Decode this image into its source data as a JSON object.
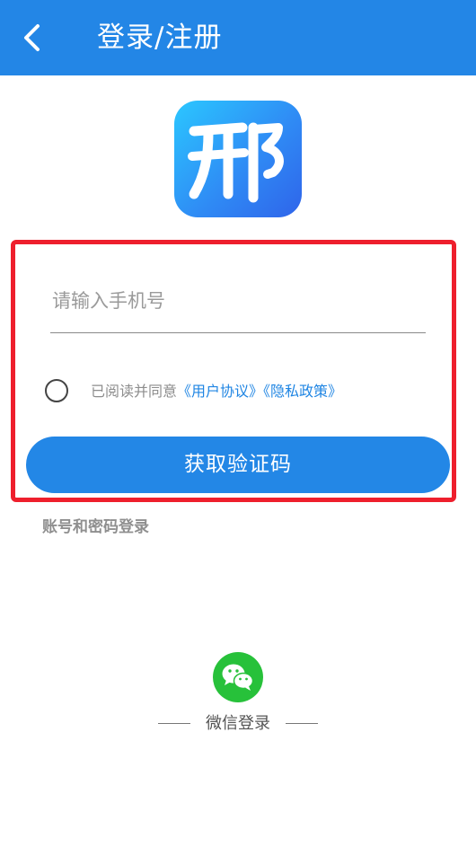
{
  "colors": {
    "header_bg": "#2386e6",
    "primary": "#2387e6",
    "highlight_border": "#ee1f2d",
    "link": "#1f85e3",
    "wechat": "#27c13a"
  },
  "header": {
    "back_icon": "chevron-left-icon",
    "title": "登录/注册"
  },
  "logo": {
    "icon": "app-logo",
    "glyph": "邢"
  },
  "form": {
    "phone_input": {
      "placeholder": "请输入手机号",
      "value": ""
    },
    "agreement": {
      "prefix": "已阅读并同意",
      "user_agreement": "《用户协议》",
      "privacy_policy": "《隐私政策》"
    },
    "submit_label": "获取验证码"
  },
  "alt_login": {
    "password_login_label": "账号和密码登录"
  },
  "social_login": {
    "wechat_icon": "wechat-icon",
    "wechat_label": "微信登录"
  }
}
